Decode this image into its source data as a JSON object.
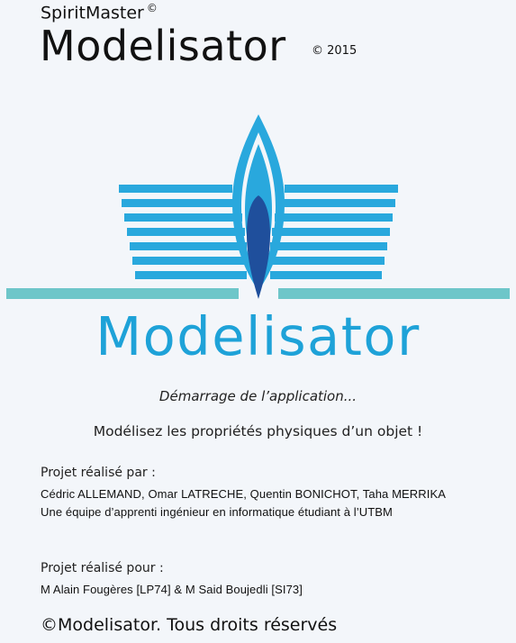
{
  "header": {
    "brand": "SpiritMaster",
    "brand_mark": "©",
    "title": "Modelisator",
    "year": "© 2015"
  },
  "logo": {
    "icon": "flame-book-logo",
    "wordmark": "Modelisator",
    "colors": {
      "light": "#6ec6c9",
      "blue": "#29a8dd",
      "dark": "#1f4f9c"
    }
  },
  "status": "Démarrage de l’application...",
  "tagline": "Modélisez les propriétés physiques d’un objet !",
  "project_by": {
    "label": "Projet réalisé par :",
    "authors": "Cédric ALLEMAND,  Omar LATRECHE, Quentin BONICHOT, Taha MERRIKA",
    "team": "Une équipe d’apprenti ingénieur en informatique étudiant à l’UTBM"
  },
  "project_for": {
    "label": "Projet réalisé pour :",
    "people": "M Alain Fougères  [LP74] & M Said Boujedli [SI73]"
  },
  "footer": "©Modelisator. Tous droits réservés"
}
